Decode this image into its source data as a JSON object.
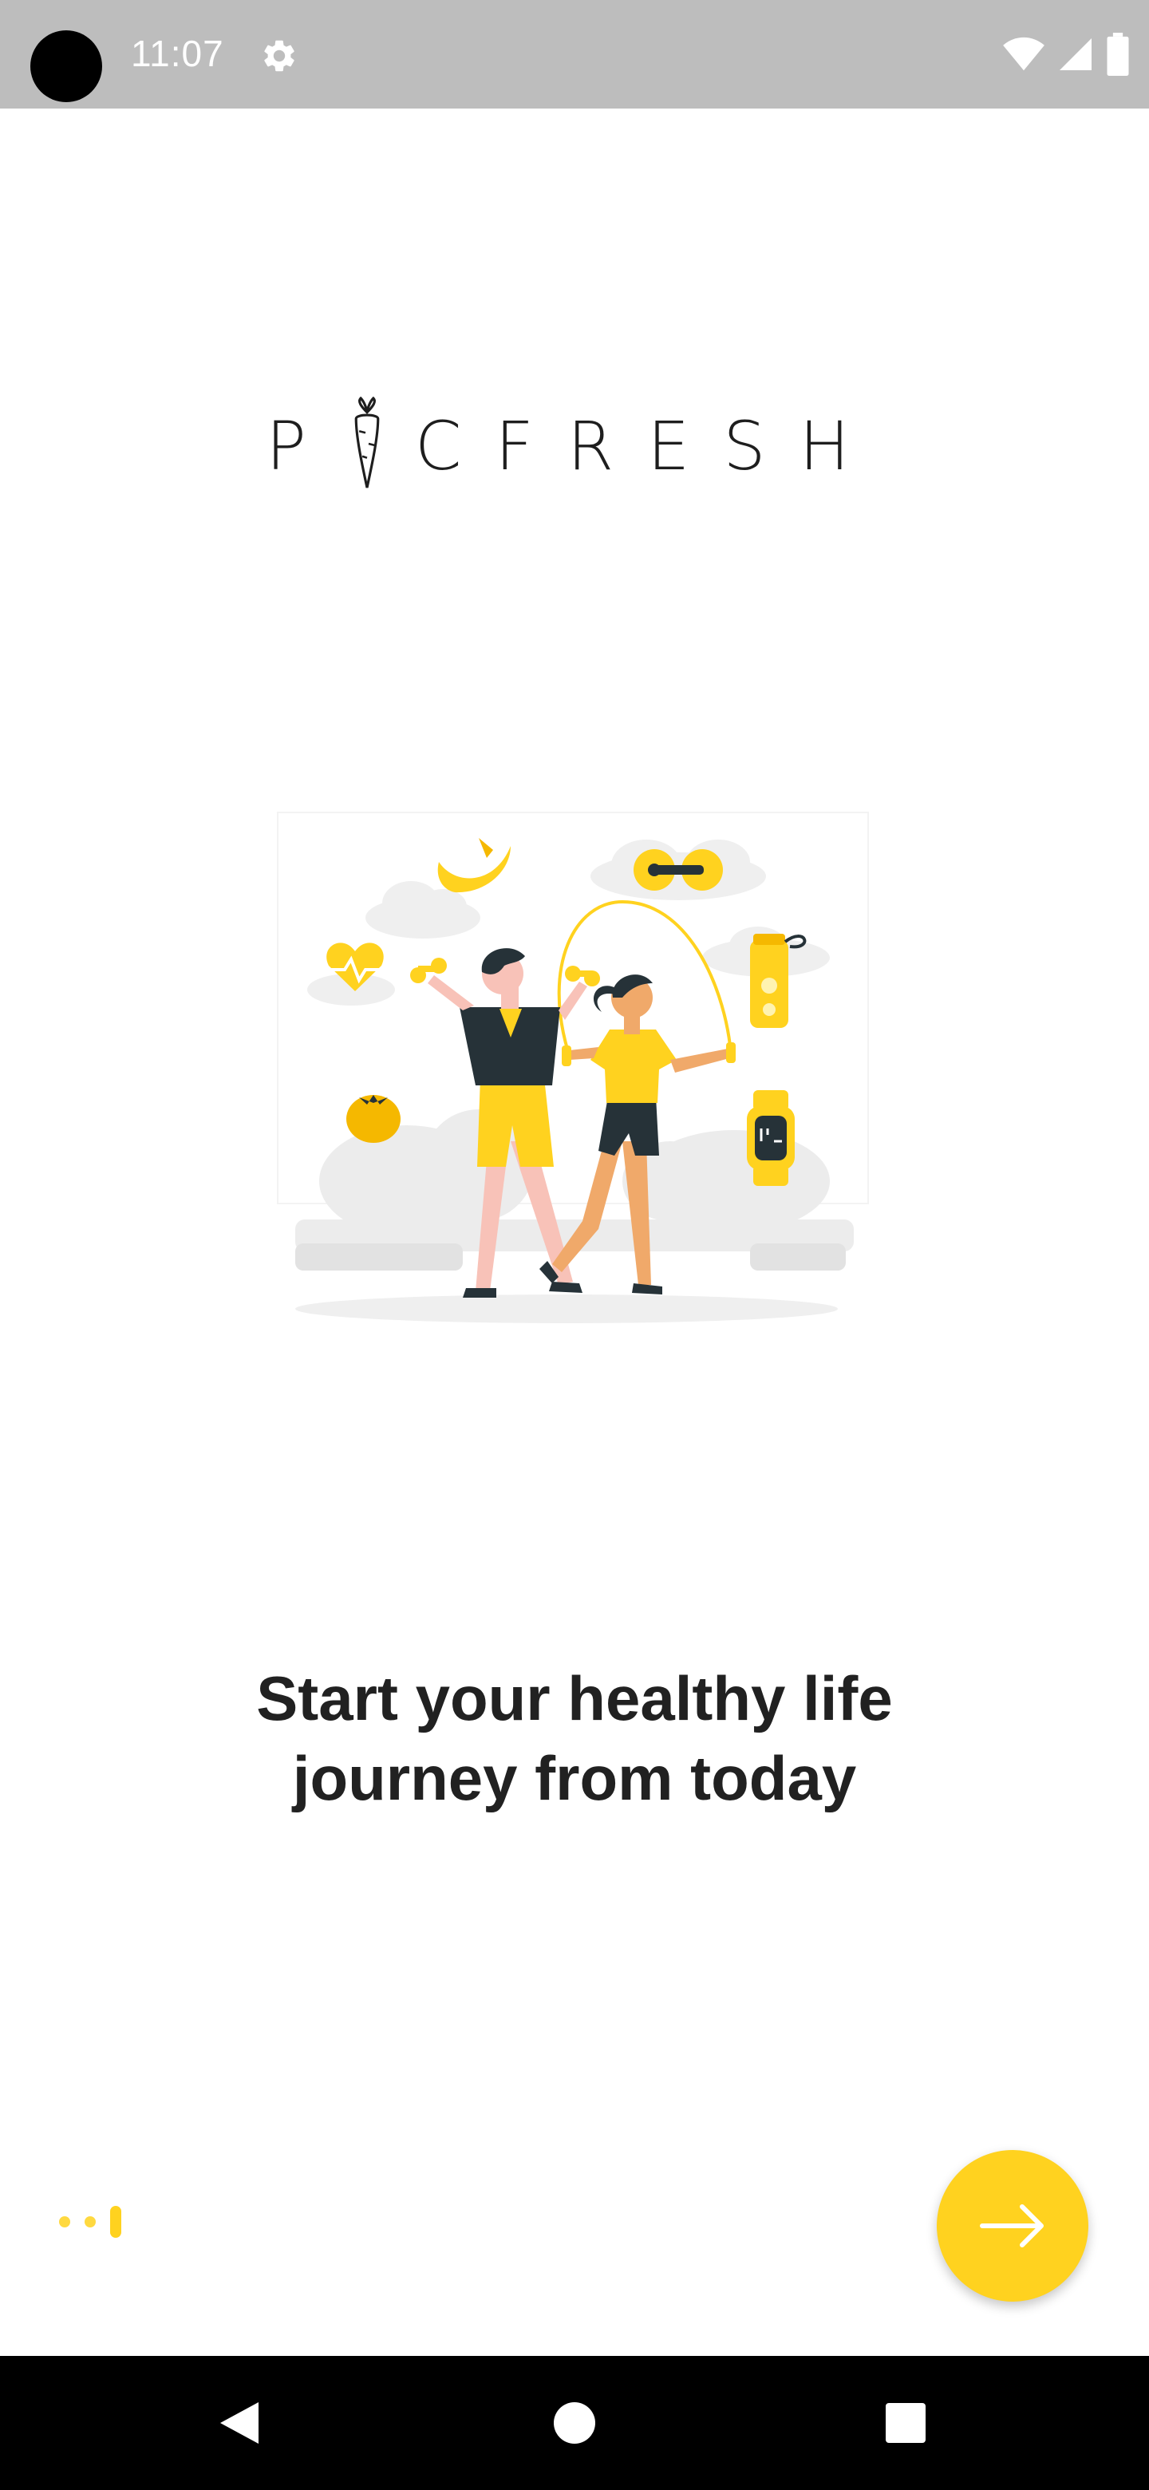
{
  "status_bar": {
    "time": "11:07",
    "icons": [
      "settings-icon",
      "wifi-icon",
      "cell-signal-icon",
      "battery-icon"
    ]
  },
  "logo": {
    "text_before": "P",
    "text_after": "CFRESH"
  },
  "onboarding": {
    "headline_line1": "Start your healthy life",
    "headline_line2": "journey from today",
    "page_count": 3,
    "active_page": 3
  },
  "next_button": {
    "icon": "arrow-right-icon"
  },
  "nav_bar": {
    "icons": [
      "back-icon",
      "home-icon",
      "recents-icon"
    ]
  },
  "colors": {
    "accent": "#ffd21f",
    "status_bar": "#bdbdbd",
    "nav_bar": "#000000",
    "text": "#212121"
  }
}
